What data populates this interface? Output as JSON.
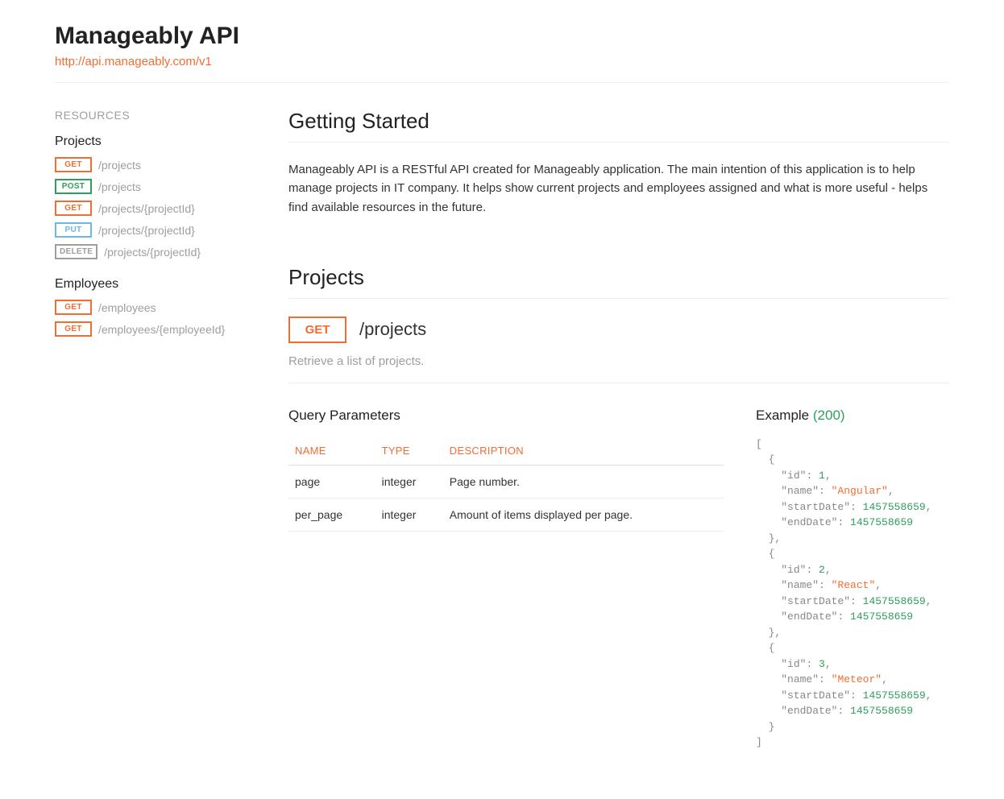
{
  "header": {
    "title": "Manageably API",
    "base_url": "http://api.manageably.com/v1"
  },
  "sidebar": {
    "heading": "RESOURCES",
    "groups": [
      {
        "title": "Projects",
        "items": [
          {
            "method": "GET",
            "path": "/projects"
          },
          {
            "method": "POST",
            "path": "/projects"
          },
          {
            "method": "GET",
            "path": "/projects/{projectId}"
          },
          {
            "method": "PUT",
            "path": "/projects/{projectId}"
          },
          {
            "method": "DELETE",
            "path": "/projects/{projectId}"
          }
        ]
      },
      {
        "title": "Employees",
        "items": [
          {
            "method": "GET",
            "path": "/employees"
          },
          {
            "method": "GET",
            "path": "/employees/{employeeId}"
          }
        ]
      }
    ]
  },
  "intro": {
    "heading": "Getting Started",
    "body": "Manageably API is a RESTful API created for Manageably application. The main intention of this application is to help manage projects in IT company. It helps show current projects and employees assigned and what is more useful - helps find available resources in the future."
  },
  "section": {
    "heading": "Projects",
    "endpoint": {
      "method": "GET",
      "path": "/projects",
      "description": "Retrieve a list of projects."
    },
    "query_params": {
      "heading": "Query Parameters",
      "columns": {
        "name": "NAME",
        "type": "TYPE",
        "description": "DESCRIPTION"
      },
      "rows": [
        {
          "name": "page",
          "type": "integer",
          "description": "Page number."
        },
        {
          "name": "per_page",
          "type": "integer",
          "description": "Amount of items displayed per page."
        }
      ]
    },
    "example": {
      "heading": "Example",
      "status": "(200)",
      "data": [
        {
          "id": 1,
          "name": "Angular",
          "startDate": 1457558659,
          "endDate": 1457558659
        },
        {
          "id": 2,
          "name": "React",
          "startDate": 1457558659,
          "endDate": 1457558659
        },
        {
          "id": 3,
          "name": "Meteor",
          "startDate": 1457558659,
          "endDate": 1457558659
        }
      ]
    }
  }
}
